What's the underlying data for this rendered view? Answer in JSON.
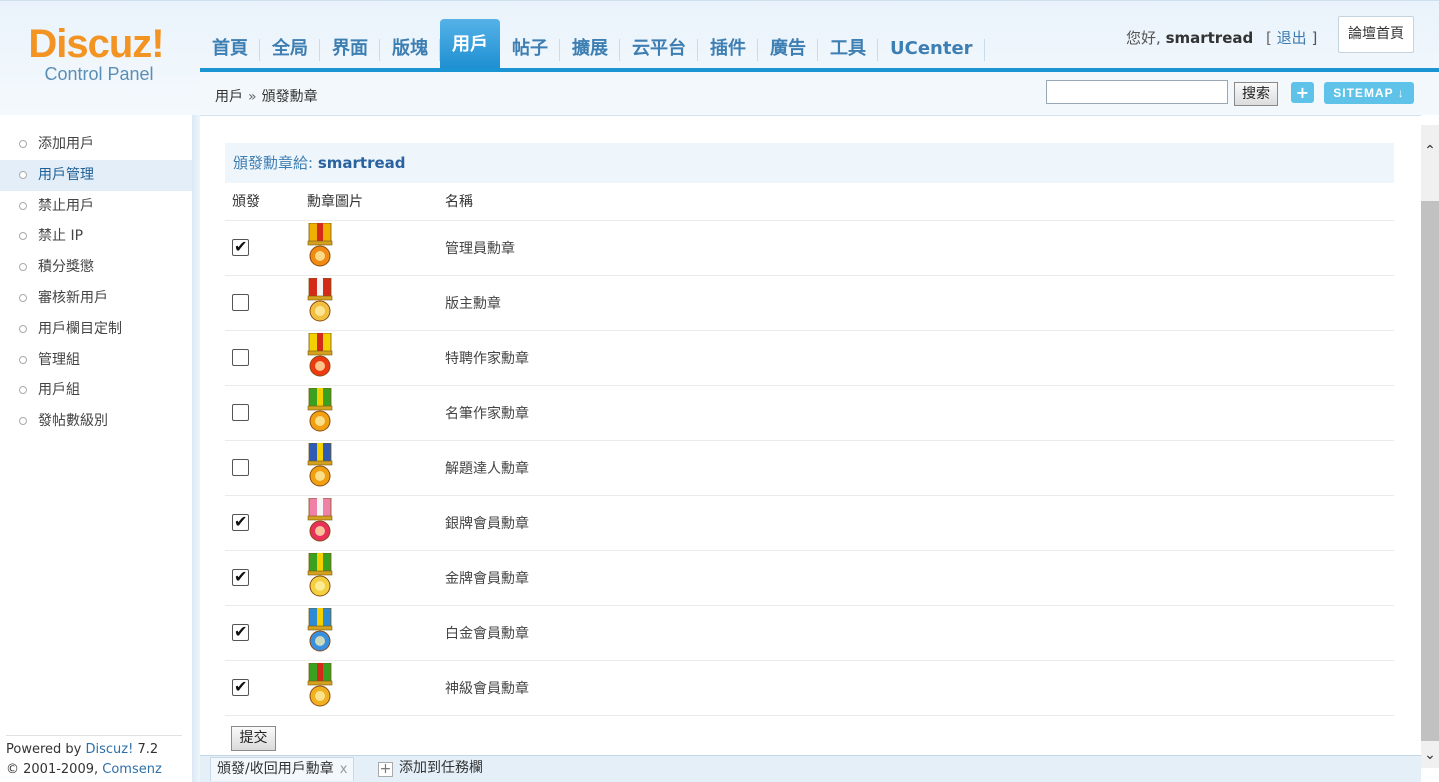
{
  "logo": {
    "brand": "Discuz!",
    "subtitle": "Control Panel"
  },
  "nav": [
    {
      "label": "首頁"
    },
    {
      "label": "全局"
    },
    {
      "label": "界面"
    },
    {
      "label": "版塊"
    },
    {
      "label": "用戶",
      "active": true
    },
    {
      "label": "帖子"
    },
    {
      "label": "擴展"
    },
    {
      "label": "云平台"
    },
    {
      "label": "插件"
    },
    {
      "label": "廣告"
    },
    {
      "label": "工具"
    },
    {
      "label": "UCenter"
    }
  ],
  "user": {
    "greeting": "您好,",
    "name": "smartread",
    "bracket_open": "[",
    "logout": "退出",
    "bracket_close": "]"
  },
  "home_button": "論壇首頁",
  "breadcrumb": {
    "parent": "用戶",
    "arrow": "»",
    "current": "頒發勳章"
  },
  "search": {
    "value": "",
    "button": "搜索"
  },
  "plus_button": "+",
  "sitemap_button": "SITEMAP ↓",
  "sidebar": {
    "items": [
      {
        "label": "添加用戶"
      },
      {
        "label": "用戶管理",
        "active": true
      },
      {
        "label": "禁止用戶"
      },
      {
        "label": "禁止 IP"
      },
      {
        "label": "積分獎懲"
      },
      {
        "label": "審核新用戶"
      },
      {
        "label": "用戶欄目定制"
      },
      {
        "label": "管理組"
      },
      {
        "label": "用戶組"
      },
      {
        "label": "發帖數級別"
      }
    ],
    "powered_prefix": "Powered by ",
    "powered_link": "Discuz!",
    "powered_version": " 7.2",
    "copyright_prefix": "© 2001-2009, ",
    "copyright_link": "Comsenz Inc."
  },
  "section": {
    "title_prefix": "頒發勳章給: ",
    "title_user": "smartread"
  },
  "table": {
    "headers": {
      "award": "頒發",
      "image": "勳章圖片",
      "name": "名稱"
    },
    "medals": [
      {
        "name": "管理員勳章",
        "checked": true,
        "ribbon": "#f0b000",
        "stripe": "#d42a1a",
        "badge": "#f08a10",
        "icon": "medal-admin-icon"
      },
      {
        "name": "版主勳章",
        "checked": false,
        "ribbon": "#d42a1a",
        "stripe": "#f5f5f5",
        "badge": "#f2c040",
        "icon": "medal-moderator-icon"
      },
      {
        "name": "特聘作家勳章",
        "checked": false,
        "ribbon": "#f5d000",
        "stripe": "#d42a1a",
        "badge": "#ee3a10",
        "icon": "medal-special-writer-icon"
      },
      {
        "name": "名筆作家勳章",
        "checked": false,
        "ribbon": "#3aa020",
        "stripe": "#f5d000",
        "badge": "#f0a010",
        "icon": "medal-famous-writer-icon"
      },
      {
        "name": "解題達人勳章",
        "checked": false,
        "ribbon": "#2d5bb5",
        "stripe": "#f5d000",
        "badge": "#f0a010",
        "icon": "medal-solver-icon"
      },
      {
        "name": "銀牌會員勳章",
        "checked": true,
        "ribbon": "#f080a8",
        "stripe": "#f5f5f5",
        "badge": "#e8305a",
        "icon": "medal-silver-member-icon"
      },
      {
        "name": "金牌會員勳章",
        "checked": true,
        "ribbon": "#3aa020",
        "stripe": "#f5d000",
        "badge": "#f2d040",
        "icon": "medal-gold-member-icon"
      },
      {
        "name": "白金會員勳章",
        "checked": true,
        "ribbon": "#2d8ad5",
        "stripe": "#f5d000",
        "badge": "#3a90e0",
        "icon": "medal-platinum-member-icon"
      },
      {
        "name": "神級會員勳章",
        "checked": true,
        "ribbon": "#3aa020",
        "stripe": "#d42a1a",
        "badge": "#f0b020",
        "icon": "medal-divine-member-icon"
      }
    ]
  },
  "submit_button": "提交",
  "taskbar": {
    "tab_label": "頒發/收回用戶勳章",
    "tab_close": "x",
    "add_label": "添加到任務欄",
    "add_icon_text": "+"
  },
  "scrollbar": {
    "up": "⌃",
    "down": "⌄"
  }
}
